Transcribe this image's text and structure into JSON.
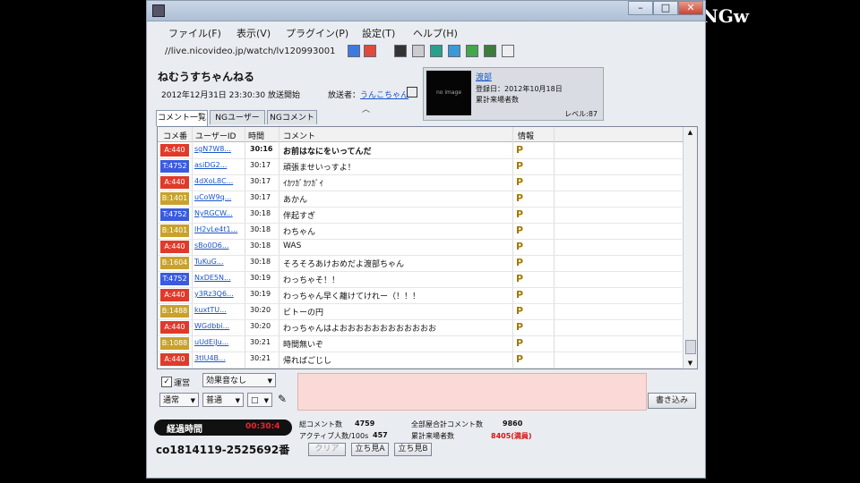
{
  "watermark": "NGw",
  "menu": [
    "ファイル(F)",
    "表示(V)",
    "プラグイン(P)",
    "設定(T)",
    "ヘルプ(H)"
  ],
  "url": "//live.nicovideo.jp/watch/lv120993001",
  "broadcast": {
    "channel": "ねむうすちゃんねる",
    "datetime": "2012年12月31日 23:30:30 放送開始",
    "broadcaster_label": "放送者：",
    "broadcaster_name": "うんこちゃん"
  },
  "user_card": {
    "thumb_text": "no image",
    "name": "渡部",
    "registered": "登録日：2012年10月18日",
    "count": "累計来場者数",
    "level": "レベル:87"
  },
  "tabs": [
    "コメント一覧",
    "NGユーザー",
    "NGコメント"
  ],
  "table": {
    "headers": [
      "コメ番",
      "ユーザーID",
      "時間",
      "コメント",
      "情報"
    ],
    "rows": [
      {
        "badge": "A:440",
        "color": "#e03a2a",
        "uid": "sgN7W8...",
        "time": "30:16",
        "comment": "お前はなにをいってんだ"
      },
      {
        "badge": "T:4752",
        "color": "#3a5be0",
        "uid": "asiDG2...",
        "time": "30:17",
        "comment": "頑張ませいっすよ！"
      },
      {
        "badge": "A:440",
        "color": "#e03a2a",
        "uid": "4dXoL8C...",
        "time": "30:17",
        "comment": "ｲｶﾂｶﾞｶﾂｶﾞｲ"
      },
      {
        "badge": "B:1401",
        "color": "#c9a12b",
        "uid": "uCoW9q...",
        "time": "30:17",
        "comment": "あかん"
      },
      {
        "badge": "T:4752",
        "color": "#3a5be0",
        "uid": "NyRGCW...",
        "time": "30:18",
        "comment": "伴起すぎ"
      },
      {
        "badge": "B:1401",
        "color": "#c9a12b",
        "uid": "lH2vLe4t1...",
        "time": "30:18",
        "comment": "わちゃん"
      },
      {
        "badge": "A:440",
        "color": "#e03a2a",
        "uid": "sBo0D6...",
        "time": "30:18",
        "comment": "WAS"
      },
      {
        "badge": "B:1604",
        "color": "#c9a12b",
        "uid": "TuKuG...",
        "time": "30:18",
        "comment": "そろそろあけおめだよ渡部ちゃん"
      },
      {
        "badge": "T:4752",
        "color": "#3a5be0",
        "uid": "NxDE5N...",
        "time": "30:19",
        "comment": "わっちゃそ！！"
      },
      {
        "badge": "A:440",
        "color": "#e03a2a",
        "uid": "y3Rz3Q6...",
        "time": "30:19",
        "comment": "わっちゃん早く離けてけれー（！！！"
      },
      {
        "badge": "B:1488",
        "color": "#c9a12b",
        "uid": "kuxtTU...",
        "time": "30:20",
        "comment": "ビトーの円"
      },
      {
        "badge": "A:440",
        "color": "#e03a2a",
        "uid": "WGdbbi...",
        "time": "30:20",
        "comment": "わっちゃんはよおおおおおおおおおおおお"
      },
      {
        "badge": "B:1088",
        "color": "#c9a12b",
        "uid": "uUdEiJu...",
        "time": "30:21",
        "comment": "時間無いぞ"
      },
      {
        "badge": "A:440",
        "color": "#e03a2a",
        "uid": "3tIU4B...",
        "time": "30:21",
        "comment": "帰ればごじし"
      }
    ]
  },
  "controls": {
    "checkbox_label": "運営",
    "effect_select": "効果音なし",
    "mode_select": "通常",
    "position_select": "普通",
    "color_select": "□",
    "write_button": "書き込み",
    "clear_button": "クリア",
    "bottom_button1": "立ち見A",
    "bottom_button2": "立ち見B"
  },
  "status": {
    "elapsed_label": "経過時間",
    "elapsed_value": "00:30:4",
    "co_id": "co1814119-2525692番",
    "comment_count_label": "総コメント数",
    "comment_count": "4759",
    "active_label": "アクティブ人数/100s",
    "active": "457",
    "total_comment_label": "全部屋合計コメント数",
    "total_comment": "9860",
    "visitors_label": "累計来場者数",
    "visitors": "8405(満員)"
  }
}
